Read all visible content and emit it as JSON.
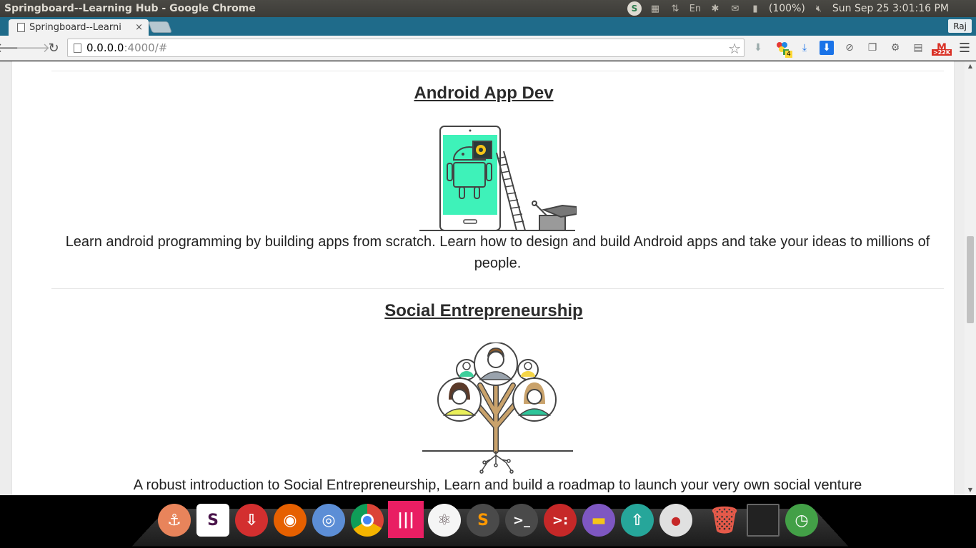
{
  "window": {
    "title": "Springboard--Learning Hub - Google Chrome"
  },
  "panel": {
    "battery": "(100%)",
    "clock": "Sun Sep 25  3:01:16 PM",
    "icons": [
      "skype-icon",
      "cpu-icon",
      "network-icon",
      "keyboard-icon",
      "bluetooth-icon",
      "messages-icon",
      "battery-icon",
      "volume-icon"
    ]
  },
  "tab": {
    "label": "Springboard--Learni",
    "close": "×"
  },
  "profile": {
    "label": "Raj"
  },
  "address": {
    "host": "0.0.0.0",
    "path": ":4000/#"
  },
  "extensions": {
    "badge_count": "4",
    "mail_badge": ">22K"
  },
  "courses": [
    {
      "title": "Android App Dev",
      "description": "Learn android programming by building apps from scratch. Learn how to design and build Android apps and take your ideas to millions of people."
    },
    {
      "title": "Social Entrepreneurship",
      "description": "A robust introduction to Social Entrepreneurship, Learn and build a roadmap to launch your very own social venture"
    }
  ],
  "dock": {
    "apps": [
      "anchor-icon",
      "slack-icon",
      "uget-icon",
      "firefox-icon",
      "chromium-icon",
      "chrome-icon",
      "gitkraken-icon",
      "atom-icon",
      "sublime-icon",
      "terminal-icon",
      "git-terminal-icon",
      "files-icon",
      "update-icon",
      "toggle-icon",
      "trash-icon",
      "workspaces-icon",
      "clock-icon"
    ]
  }
}
